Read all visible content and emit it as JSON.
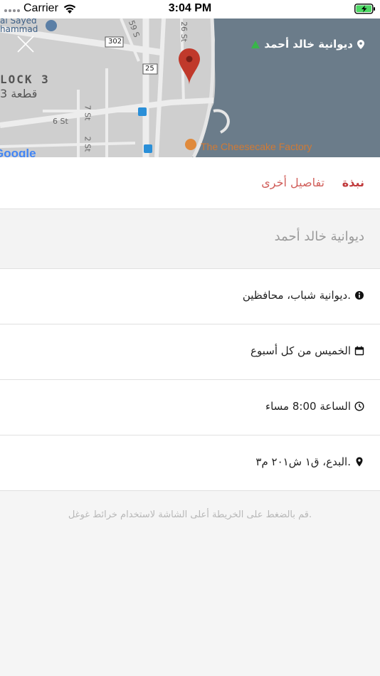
{
  "status_bar": {
    "carrier": "Carrier",
    "time": "3:04 PM"
  },
  "map": {
    "place_title": "ديوانية خالد أحمد",
    "labels": {
      "block": "LOCK 3",
      "block_ar": "قطعة 3",
      "street_59": "59 S",
      "road_302": "302",
      "road_25": "25",
      "street_26": "26 St",
      "street_6": "6 St",
      "street_7": "7 St",
      "street_2": "2 St",
      "poi_name": "The Cheesecake Factory",
      "poi_top": "al Sayed",
      "poi_top2": "hammad",
      "google": "Google"
    },
    "colors": {
      "land": "#cfcfcf",
      "road": "#ededed",
      "water": "#6b7c8a",
      "pin": "#c0392b"
    }
  },
  "tabs": [
    {
      "label": "نبذة",
      "active": true
    },
    {
      "label": "تفاصيل أخرى",
      "active": false
    }
  ],
  "detail": {
    "title": "ديوانية خالد أحمد",
    "rows": [
      {
        "icon": "info-icon",
        "text": "ديوانية شباب، محافظين."
      },
      {
        "icon": "calendar-icon",
        "text": "الخميس من كل أسبوع"
      },
      {
        "icon": "clock-icon",
        "text": "الساعة 8:00 مساء"
      },
      {
        "icon": "location-pin-icon",
        "text": "البدع، ق١ ش٢٠١ م٣."
      }
    ]
  },
  "hint": "قم بالضغط على الخريطة أعلى الشاشة لاستخدام خرائط غوغل."
}
